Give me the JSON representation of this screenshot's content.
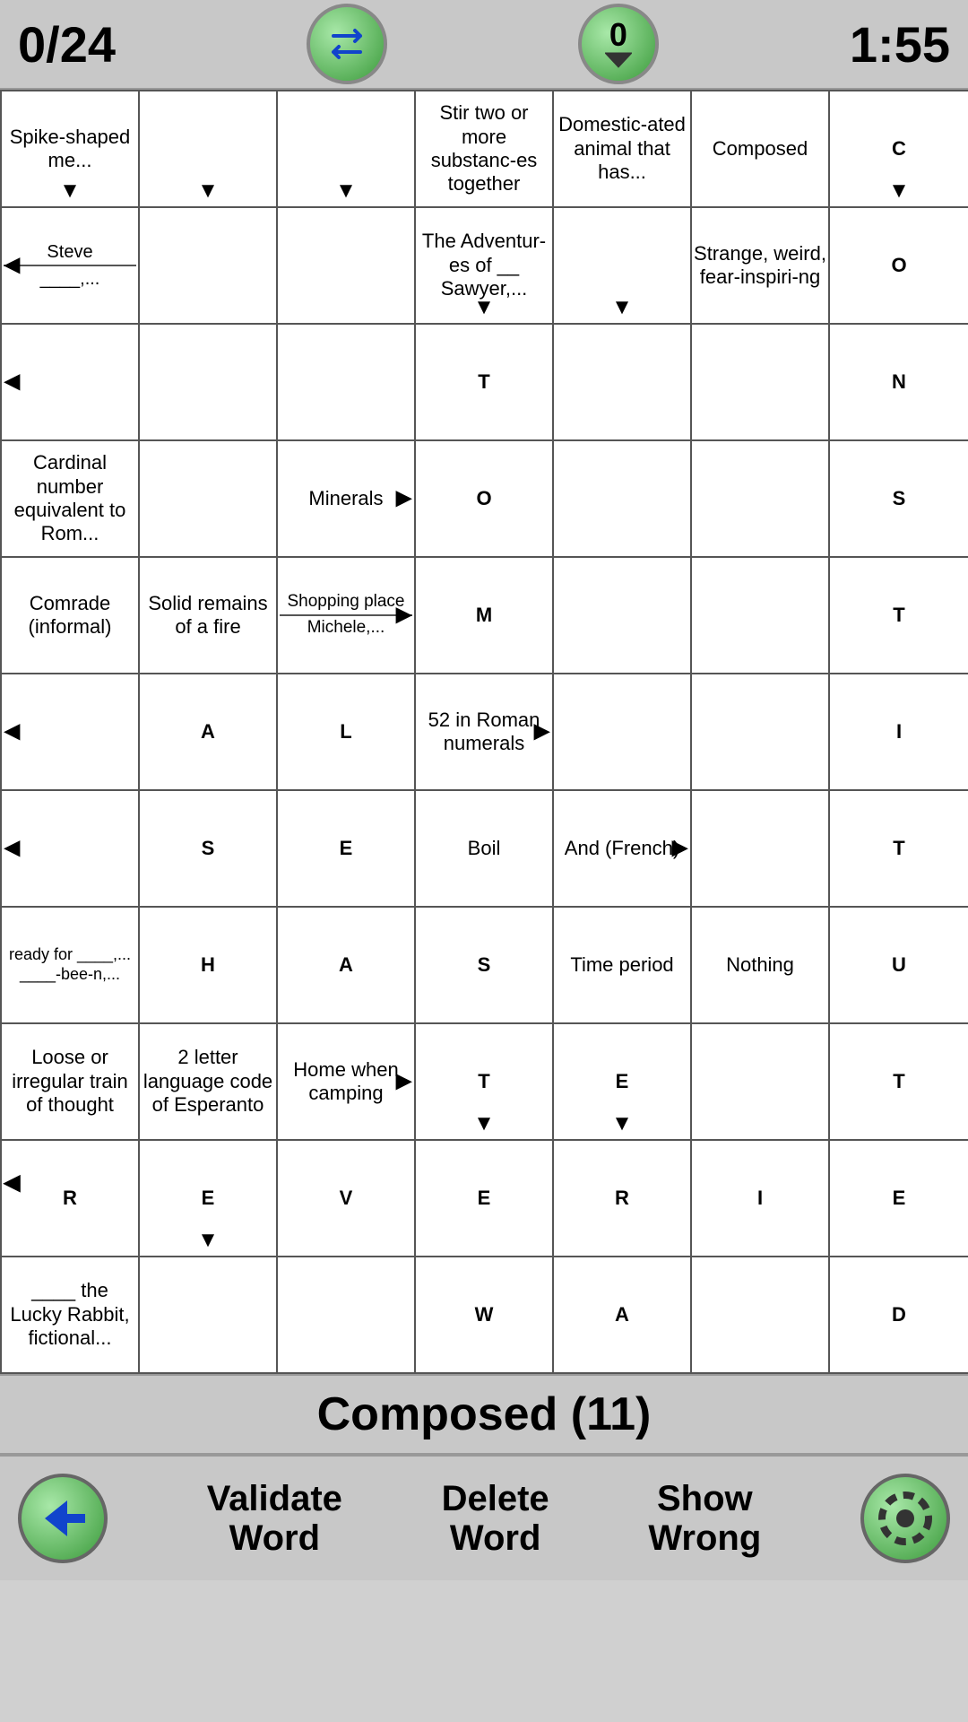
{
  "header": {
    "score": "0/24",
    "counter": "0",
    "timer": "1:55"
  },
  "status": {
    "text": "Composed (11)"
  },
  "footer": {
    "validate_label": "Validate\nWord",
    "delete_label": "Delete\nWord",
    "show_wrong_label": "Show\nWrong"
  },
  "grid": {
    "rows": [
      [
        {
          "type": "clue",
          "text": "Spike-shaped me...",
          "arrows": [
            "down"
          ]
        },
        {
          "type": "empty",
          "arrows": [
            "down"
          ]
        },
        {
          "type": "empty",
          "arrows": [
            "down"
          ]
        },
        {
          "type": "clue",
          "text": "Stir two or more substanc-es together",
          "arrows": []
        },
        {
          "type": "clue",
          "text": "Domestic-ated animal that has...",
          "arrows": []
        },
        {
          "type": "clue",
          "text": "Composed",
          "arrows": []
        },
        {
          "type": "letter",
          "text": "C",
          "bg": "yellow",
          "arrows": [
            "down"
          ]
        }
      ],
      [
        {
          "type": "clue2",
          "top": "Steve",
          "bottom": "____,...",
          "arrows": [
            "left"
          ]
        },
        {
          "type": "empty",
          "arrows": []
        },
        {
          "type": "empty",
          "arrows": []
        },
        {
          "type": "clue",
          "text": "The Adventur-es of __ Sawyer,...",
          "arrows": [
            "down"
          ]
        },
        {
          "type": "empty",
          "arrows": [
            "down"
          ]
        },
        {
          "type": "clue",
          "text": "Strange, weird, fear-inspiri-ng",
          "arrows": []
        },
        {
          "type": "letter",
          "text": "O",
          "bg": "purple",
          "arrows": []
        }
      ],
      [
        {
          "type": "empty",
          "arrows": [
            "left"
          ]
        },
        {
          "type": "empty",
          "arrows": []
        },
        {
          "type": "empty",
          "arrows": []
        },
        {
          "type": "letter",
          "text": "T",
          "bg": "white",
          "arrows": []
        },
        {
          "type": "empty",
          "arrows": []
        },
        {
          "type": "empty",
          "arrows": []
        },
        {
          "type": "letter",
          "text": "N",
          "bg": "purple",
          "arrows": []
        }
      ],
      [
        {
          "type": "clue",
          "text": "Cardinal number equivalent to Rom...",
          "arrows": []
        },
        {
          "type": "empty",
          "arrows": []
        },
        {
          "type": "clue",
          "text": "Minerals",
          "arrows": [
            "right"
          ]
        },
        {
          "type": "letter",
          "text": "O",
          "bg": "white",
          "arrows": []
        },
        {
          "type": "empty",
          "arrows": []
        },
        {
          "type": "empty",
          "arrows": []
        },
        {
          "type": "letter",
          "text": "S",
          "bg": "purple",
          "arrows": []
        }
      ],
      [
        {
          "type": "clue",
          "text": "Comrade (informal)",
          "arrows": []
        },
        {
          "type": "clue",
          "text": "Solid remains of a fire",
          "arrows": []
        },
        {
          "type": "clue2",
          "top": "Shopping place",
          "bottom": "Michele,...",
          "arrows": [
            "right"
          ]
        },
        {
          "type": "letter",
          "text": "M",
          "bg": "white",
          "arrows": []
        },
        {
          "type": "empty",
          "arrows": []
        },
        {
          "type": "empty",
          "arrows": []
        },
        {
          "type": "letter",
          "text": "T",
          "bg": "purple",
          "arrows": []
        }
      ],
      [
        {
          "type": "empty",
          "arrows": [
            "left"
          ]
        },
        {
          "type": "letter",
          "text": "A",
          "bg": "white",
          "arrows": []
        },
        {
          "type": "letter",
          "text": "L",
          "bg": "white",
          "arrows": []
        },
        {
          "type": "clue",
          "text": "52 in Roman numerals",
          "arrows": [
            "right"
          ]
        },
        {
          "type": "empty",
          "arrows": []
        },
        {
          "type": "empty",
          "arrows": []
        },
        {
          "type": "letter",
          "text": "I",
          "bg": "purple",
          "arrows": []
        }
      ],
      [
        {
          "type": "empty",
          "arrows": [
            "left"
          ]
        },
        {
          "type": "letter",
          "text": "S",
          "bg": "white",
          "arrows": []
        },
        {
          "type": "letter",
          "text": "E",
          "bg": "white",
          "arrows": []
        },
        {
          "type": "clue",
          "text": "Boil",
          "arrows": []
        },
        {
          "type": "clue",
          "text": "And (French)",
          "arrows": [
            "right"
          ]
        },
        {
          "type": "empty",
          "arrows": []
        },
        {
          "type": "letter",
          "text": "T",
          "bg": "purple",
          "arrows": []
        }
      ],
      [
        {
          "type": "clue",
          "text": "ready for ____,...\n____-bee-n,...",
          "arrows": []
        },
        {
          "type": "letter",
          "text": "H",
          "bg": "white",
          "arrows": []
        },
        {
          "type": "letter",
          "text": "A",
          "bg": "white",
          "arrows": []
        },
        {
          "type": "letter",
          "text": "S",
          "bg": "white",
          "arrows": []
        },
        {
          "type": "clue",
          "text": "Time period",
          "arrows": []
        },
        {
          "type": "clue",
          "text": "Nothing",
          "arrows": []
        },
        {
          "type": "letter",
          "text": "U",
          "bg": "purple",
          "arrows": []
        }
      ],
      [
        {
          "type": "clue",
          "text": "Loose or irregular train of thought",
          "arrows": []
        },
        {
          "type": "clue",
          "text": "2 letter language code of Esperanto",
          "arrows": []
        },
        {
          "type": "clue",
          "text": "Home when camping",
          "arrows": [
            "right"
          ]
        },
        {
          "type": "letter",
          "text": "T",
          "bg": "white",
          "arrows": [
            "down"
          ]
        },
        {
          "type": "letter",
          "text": "E",
          "bg": "white",
          "arrows": [
            "down"
          ]
        },
        {
          "type": "empty",
          "arrows": []
        },
        {
          "type": "letter",
          "text": "T",
          "bg": "purple",
          "arrows": []
        }
      ],
      [
        {
          "type": "letter",
          "text": "R",
          "bg": "white",
          "arrows": [
            "left",
            "down"
          ]
        },
        {
          "type": "letter",
          "text": "E",
          "bg": "white",
          "arrows": [
            "down"
          ]
        },
        {
          "type": "letter",
          "text": "V",
          "bg": "white",
          "arrows": []
        },
        {
          "type": "letter",
          "text": "E",
          "bg": "white",
          "arrows": []
        },
        {
          "type": "letter",
          "text": "R",
          "bg": "white",
          "arrows": []
        },
        {
          "type": "letter",
          "text": "I",
          "bg": "white",
          "arrows": []
        },
        {
          "type": "letter",
          "text": "E",
          "bg": "purple",
          "arrows": []
        }
      ],
      [
        {
          "type": "clue",
          "text": "____ the Lucky Rabbit, fictional...",
          "arrows": []
        },
        {
          "type": "empty",
          "arrows": []
        },
        {
          "type": "empty",
          "arrows": []
        },
        {
          "type": "letter",
          "text": "W",
          "bg": "white",
          "arrows": []
        },
        {
          "type": "letter",
          "text": "A",
          "bg": "white",
          "arrows": []
        },
        {
          "type": "empty",
          "arrows": []
        },
        {
          "type": "letter",
          "text": "D",
          "bg": "purple",
          "arrows": []
        }
      ]
    ]
  }
}
